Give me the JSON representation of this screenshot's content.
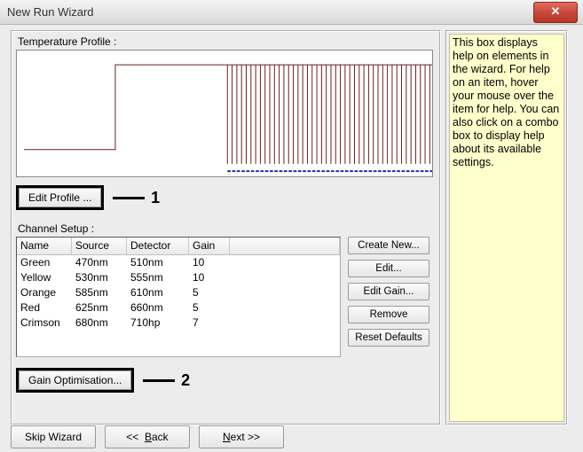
{
  "window": {
    "title": "New Run Wizard",
    "close_glyph": "✕"
  },
  "help": {
    "text": "This box displays help on elements in the wizard. For help on an item, hover your mouse over the item for help. You can also click on a combo box to display help about its available settings."
  },
  "profile": {
    "label": "Temperature Profile :",
    "edit_button": "Edit Profile ...",
    "annotation": "1"
  },
  "channel": {
    "label": "Channel Setup :",
    "headers": {
      "name": "Name",
      "source": "Source",
      "detector": "Detector",
      "gain": "Gain"
    },
    "rows": [
      {
        "name": "Green",
        "source": "470nm",
        "detector": "510nm",
        "gain": "10"
      },
      {
        "name": "Yellow",
        "source": "530nm",
        "detector": "555nm",
        "gain": "10"
      },
      {
        "name": "Orange",
        "source": "585nm",
        "detector": "610nm",
        "gain": "5"
      },
      {
        "name": "Red",
        "source": "625nm",
        "detector": "660nm",
        "gain": "5"
      },
      {
        "name": "Crimson",
        "source": "680nm",
        "detector": "710hp",
        "gain": "7"
      }
    ],
    "side_buttons": {
      "create": "Create New...",
      "edit": "Edit...",
      "edit_gain": "Edit Gain...",
      "remove": "Remove",
      "reset": "Reset Defaults"
    },
    "gain_opt_button": "Gain Optimisation...",
    "gain_annotation": "2"
  },
  "nav": {
    "skip": "Skip Wizard",
    "back": "<<  Back",
    "next": "Next >>"
  },
  "chart_data": {
    "type": "line",
    "title": "",
    "xlabel": "",
    "ylabel": "",
    "description": "PCR temperature profile: initial hold (flat), denaturation step (high plateau), then ~45 repeated cycling spikes",
    "segments": [
      {
        "kind": "hold",
        "level": 0.18,
        "width": 0.22
      },
      {
        "kind": "step_up",
        "level": 0.95
      },
      {
        "kind": "plateau",
        "level": 0.95,
        "width": 0.27
      },
      {
        "kind": "cycles",
        "count": 45,
        "low": 0.05,
        "high": 0.95,
        "width": 0.51
      }
    ]
  }
}
